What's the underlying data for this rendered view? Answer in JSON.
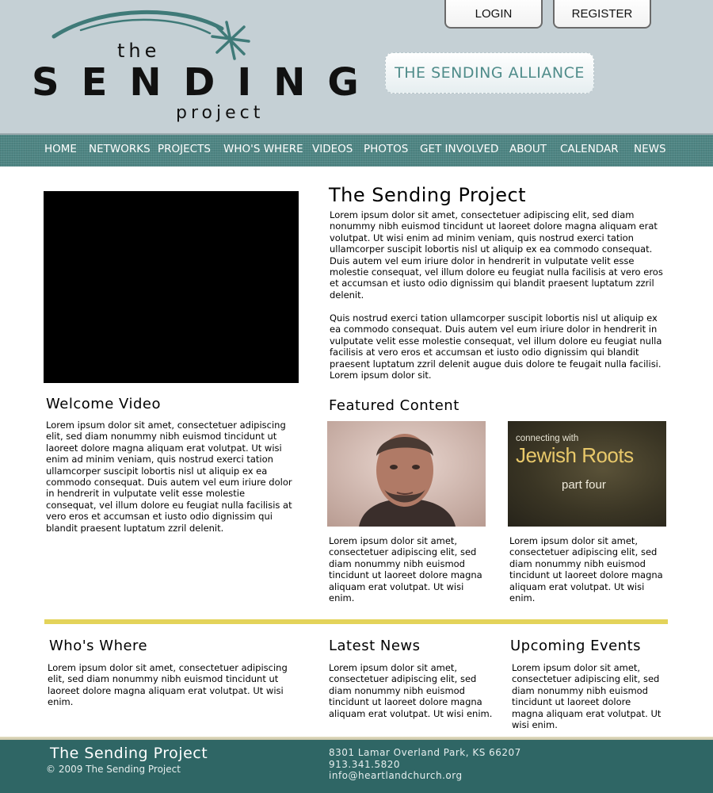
{
  "header": {
    "logo": {
      "the": "the",
      "sending": "SENDING",
      "project": "project"
    },
    "login_label": "LOGIN",
    "register_label": "REGISTER",
    "alliance_label": "THE SENDING ALLIANCE"
  },
  "nav": {
    "items": [
      {
        "label": "HOME"
      },
      {
        "label": "NETWORKS"
      },
      {
        "label": "PROJECTS"
      },
      {
        "label": "WHO'S WHERE"
      },
      {
        "label": "VIDEOS"
      },
      {
        "label": "PHOTOS"
      },
      {
        "label": "GET INVOLVED"
      },
      {
        "label": "ABOUT"
      },
      {
        "label": "CALENDAR"
      },
      {
        "label": "NEWS"
      }
    ]
  },
  "intro": {
    "title": "The Sending Project",
    "p1": "Lorem ipsum dolor sit amet, consectetuer adipiscing elit, sed diam nonummy nibh euismod tincidunt ut laoreet dolore magna aliquam erat volutpat. Ut wisi enim ad minim veniam, quis nostrud exerci tation ullamcorper suscipit lobortis nisl ut aliquip ex ea commodo consequat. Duis autem vel eum iriure dolor in hendrerit in vulputate velit esse molestie consequat, vel illum dolore eu feugiat nulla facilisis at vero eros et accumsan et iusto odio dignissim qui blandit praesent luptatum zzril delenit.",
    "p2": "Quis nostrud exerci tation ullamcorper suscipit lobortis nisl ut aliquip ex ea commodo consequat. Duis autem vel eum iriure dolor in hendrerit in vulputate velit esse molestie consequat, vel illum dolore eu feugiat nulla facilisis at vero eros et accumsan et iusto odio dignissim qui blandit praesent luptatum zzril delenit augue duis dolore te feugait nulla facilisi. Lorem ipsum dolor sit."
  },
  "welcome": {
    "title": "Welcome Video",
    "text": "Lorem ipsum dolor sit amet, consectetuer adipiscing elit, sed diam nonummy nibh euismod tincidunt ut laoreet dolore magna aliquam erat volutpat. Ut wisi enim ad minim veniam, quis nostrud exerci tation ullamcorper suscipit lobortis nisl ut aliquip ex ea commodo consequat. Duis autem vel eum iriure dolor in hendrerit in vulputate velit esse molestie consequat, vel illum dolore eu feugiat nulla facilisis at vero eros et accumsan et iusto odio dignissim qui blandit praesent luptatum zzril delenit."
  },
  "featured": {
    "title": "Featured Content",
    "items": [
      {
        "text": "Lorem ipsum dolor sit amet, consectetuer adipiscing elit, sed diam nonummy nibh euismod tincidunt ut laoreet dolore magna aliquam erat volutpat. Ut wisi enim."
      },
      {
        "thumb_line1": "connecting with",
        "thumb_line2": "Jewish Roots",
        "thumb_line3": "part four",
        "text": "Lorem ipsum dolor sit amet, consectetuer adipiscing elit, sed diam nonummy nibh euismod tincidunt ut laoreet dolore magna aliquam erat volutpat. Ut wisi enim."
      }
    ]
  },
  "sections": {
    "whos_where": {
      "title": "Who's Where",
      "text": "Lorem ipsum dolor sit amet, consectetuer adipiscing elit, sed diam nonummy nibh euismod tincidunt ut laoreet dolore magna aliquam erat volutpat. Ut wisi enim."
    },
    "news": {
      "title": "Latest News",
      "text": "Lorem ipsum dolor sit amet, consectetuer adipiscing elit, sed diam nonummy nibh euismod tincidunt ut laoreet dolore magna aliquam erat volutpat. Ut wisi enim."
    },
    "events": {
      "title": "Upcoming Events",
      "text": "Lorem ipsum dolor sit amet, consectetuer adipiscing elit, sed diam nonummy nibh euismod tincidunt ut laoreet dolore magna aliquam erat volutpat. Ut wisi enim."
    }
  },
  "footer": {
    "title": "The Sending Project",
    "copyright": "© 2009 The Sending Project",
    "address": "8301 Lamar Overland Park, KS 66207",
    "phone": "913.341.5820",
    "email": "info@heartlandchurch.org"
  },
  "colors": {
    "header_bg": "#c5d0d5",
    "nav_bg": "#4e8583",
    "teal_accent": "#2f6665",
    "divider_yellow": "#e3d35a"
  }
}
